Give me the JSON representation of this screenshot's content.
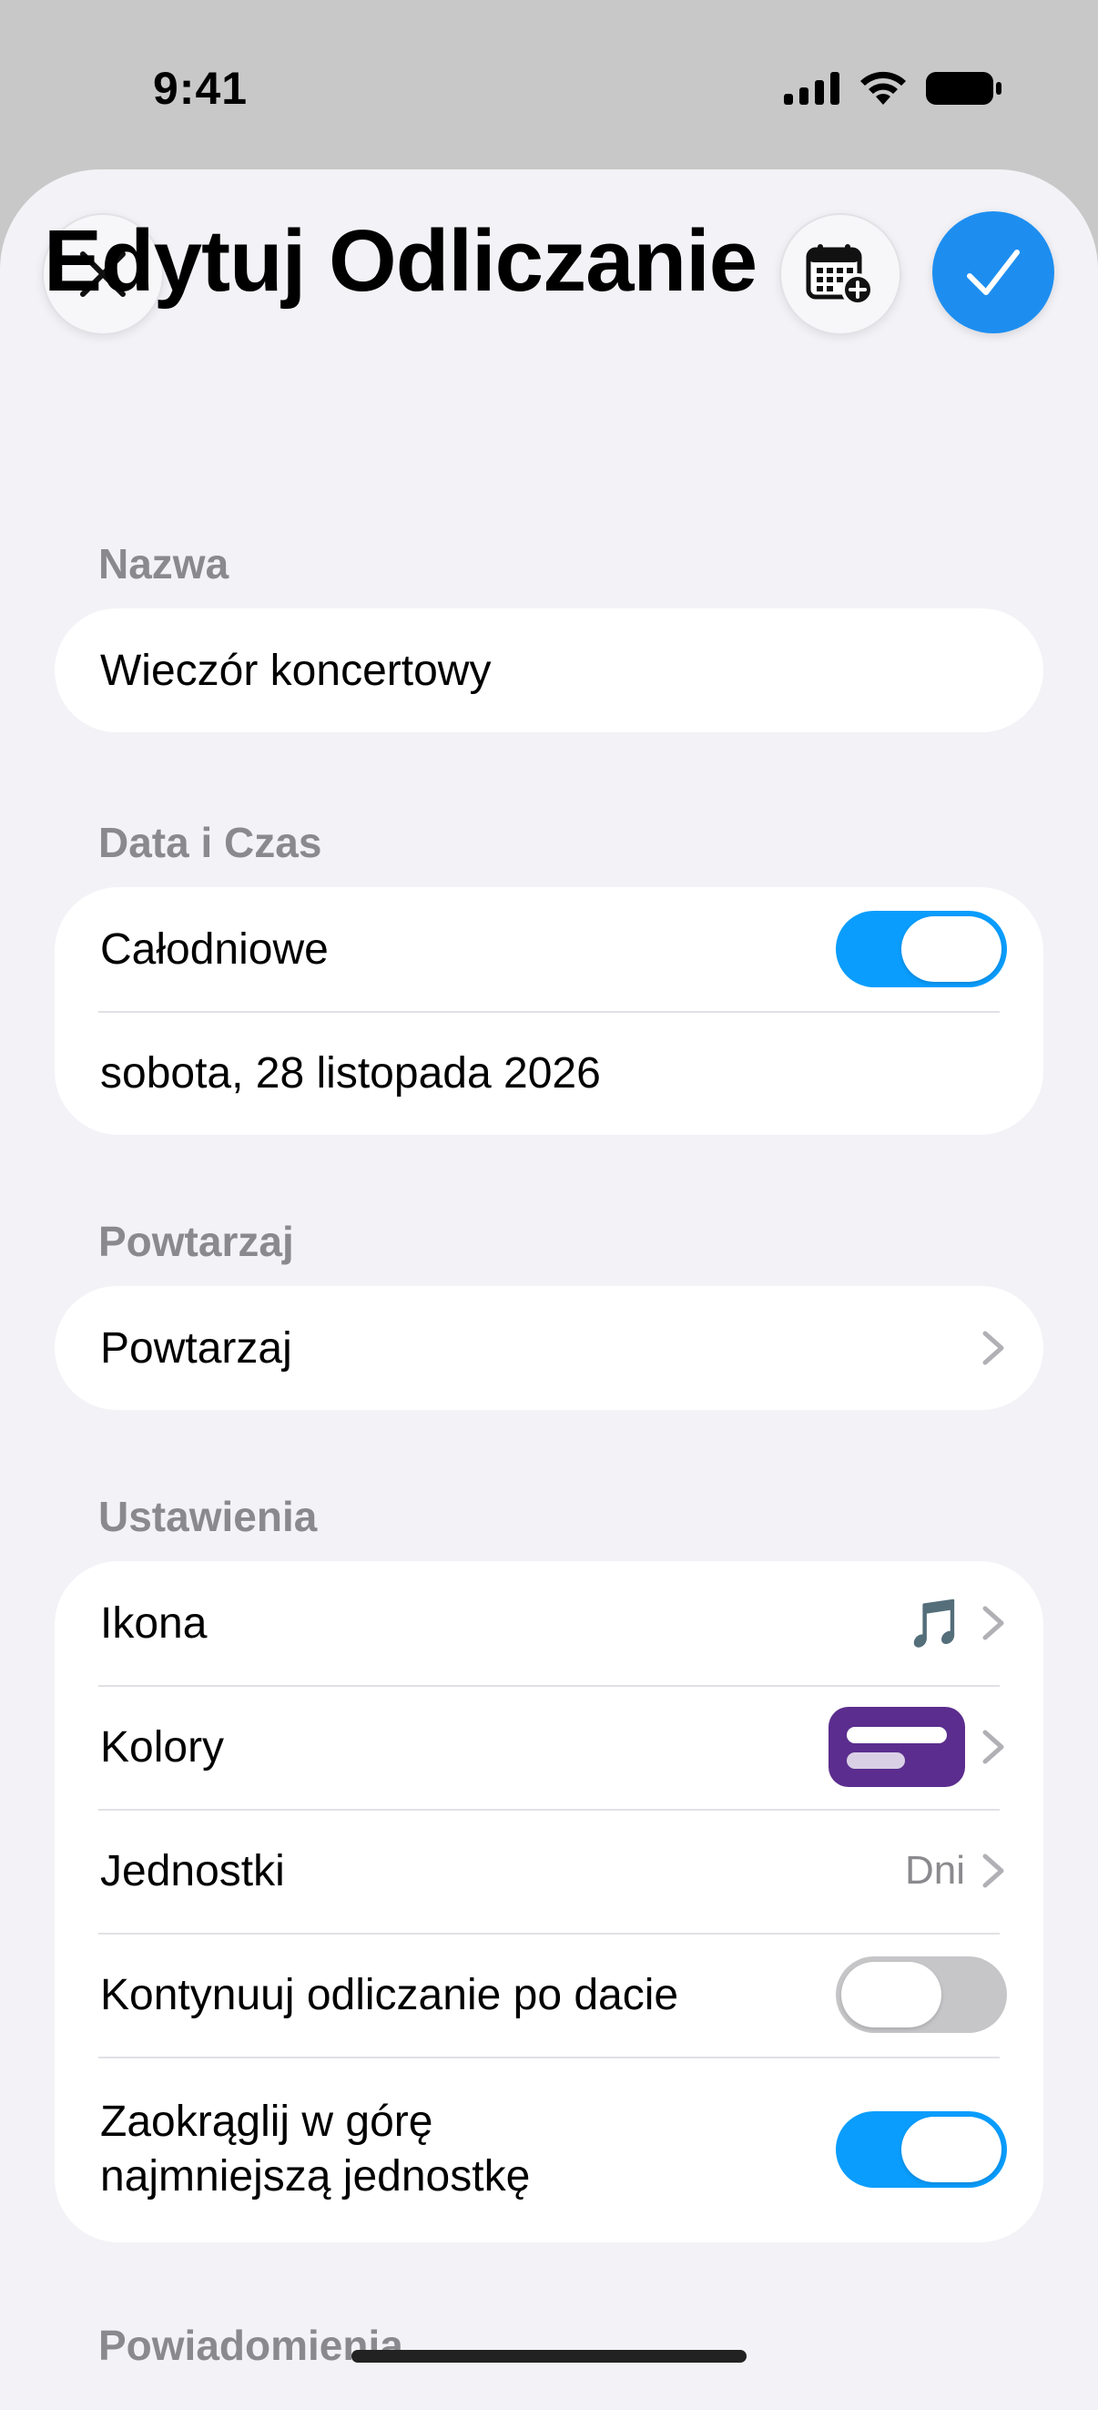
{
  "status_bar": {
    "time": "9:41"
  },
  "header": {
    "title": "Edytuj Odliczanie",
    "close_icon": "close-icon",
    "calendar_icon": "calendar-add-icon",
    "confirm_icon": "checkmark-icon"
  },
  "sections": {
    "name": {
      "header": "Nazwa",
      "value": "Wieczór koncertowy"
    },
    "datetime": {
      "header": "Data i Czas",
      "all_day_label": "Całodniowe",
      "all_day_on": true,
      "date_value": "sobota, 28 listopada 2026"
    },
    "repeat": {
      "header": "Powtarzaj",
      "row_label": "Powtarzaj"
    },
    "settings": {
      "header": "Ustawienia",
      "icon_label": "Ikona",
      "icon_value": "🎵",
      "colors_label": "Kolory",
      "color_value": "#5b2d8e",
      "units_label": "Jednostki",
      "units_value": "Dni",
      "continue_label": "Kontynuuj odliczanie po dacie",
      "continue_on": false,
      "round_label_line1": "Zaokrąglij w górę",
      "round_label_line2": "najmniejszą jednostkę",
      "round_on": true
    },
    "notifications": {
      "header": "Powiadomienia"
    }
  },
  "colors": {
    "accent": "#1d8ef0",
    "toggle_on": "#0a9dfd",
    "background": "#f2f2f7"
  }
}
